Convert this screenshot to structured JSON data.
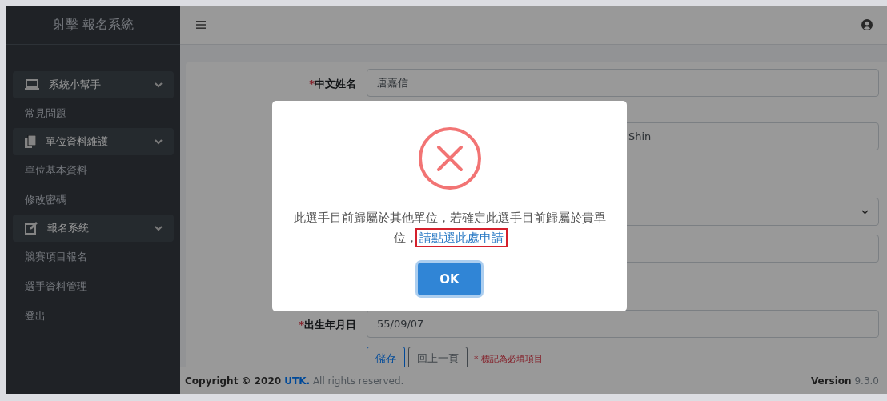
{
  "sidebar": {
    "title": "射擊 報名系統",
    "groups": [
      {
        "label": "系統小幫手",
        "kind": "laptop",
        "items": [
          "常見問題"
        ]
      },
      {
        "label": "單位資料維護",
        "kind": "copy",
        "items": [
          "單位基本資料",
          "修改密碼"
        ]
      },
      {
        "label": "報名系統",
        "kind": "edit",
        "items": [
          "競賽項目報名",
          "選手資料管理",
          "登出"
        ]
      }
    ]
  },
  "form": {
    "rows": [
      {
        "label": "中文姓名",
        "required_mark": "*",
        "kind": "input",
        "value": "唐嘉信"
      },
      {
        "kind": "input",
        "value": "Shin"
      },
      {
        "kind": "select",
        "value": ""
      },
      {
        "kind": "input",
        "value": ""
      },
      {
        "label": "出生年月日",
        "required_mark": "*",
        "kind": "input",
        "value": "55/09/07"
      }
    ],
    "buttons": [
      {
        "label": "儲存",
        "kind": "primary"
      },
      {
        "label": "回上一頁",
        "kind": "default"
      }
    ],
    "required_note": "* 標記為必填項目"
  },
  "footer": {
    "copyright_prefix": "Copyright © 2020",
    "brand": "UTK.",
    "copyright_suffix": "All rights reserved.",
    "version_label": "Version",
    "version": "9.3.0"
  },
  "dialog": {
    "kind": "error",
    "message": "此選手目前歸屬於其他單位，若確定此選手目前歸屬於貴單位，",
    "link": "請點選此處申請",
    "button": "OK"
  }
}
